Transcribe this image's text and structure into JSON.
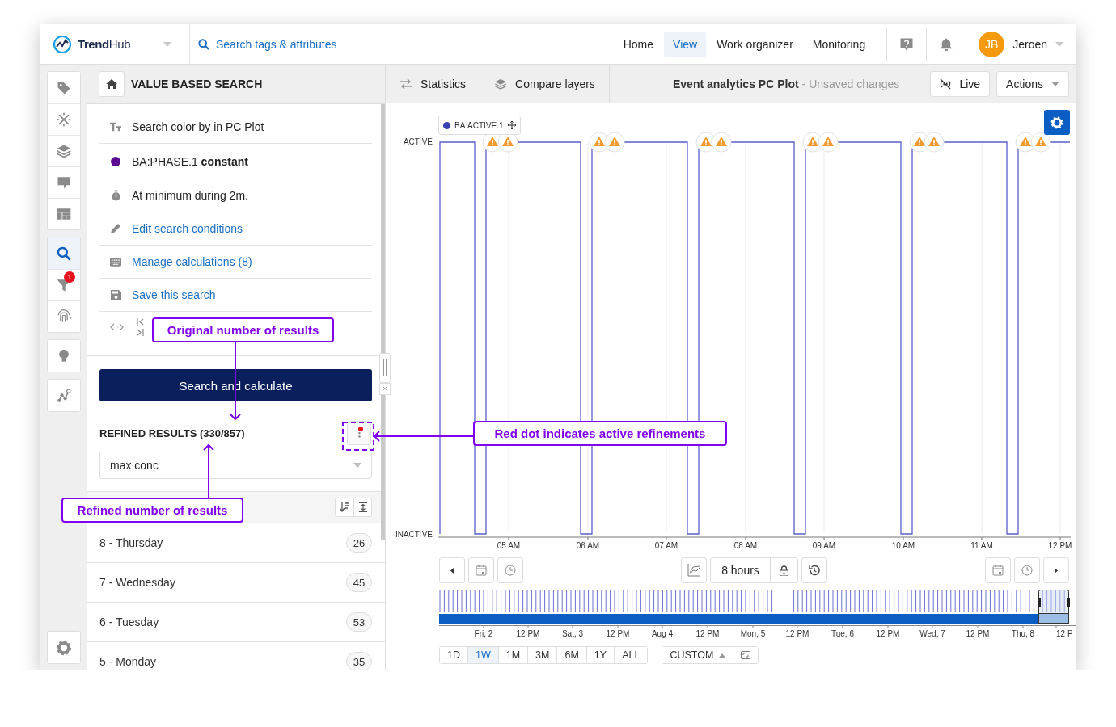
{
  "top_bar": {
    "brand": "**Trend**Hub",
    "search": "Search tags & attributes",
    "nav": [
      {
        "label": "Home",
        "selected": false
      },
      {
        "label": "View",
        "selected": true
      },
      {
        "label": "Work organizer",
        "selected": false
      },
      {
        "label": "Monitoring",
        "selected": false
      }
    ],
    "user": {
      "initials": "JB",
      "name": "Jeroen"
    }
  },
  "rail": {
    "groups": [
      {
        "items": [
          {
            "selected": false
          },
          {
            "selected": false
          },
          {
            "selected": false
          },
          {
            "selected": false
          },
          {
            "selected": false
          }
        ]
      },
      {
        "items": [
          {
            "selected": true
          },
          {
            "selected": false,
            "badge": "1"
          },
          {
            "selected": false
          }
        ]
      },
      {
        "items": [
          {
            "selected": false
          }
        ]
      },
      {
        "items": [
          {
            "selected": false
          }
        ]
      }
    ]
  },
  "search_panel": {
    "title": "VALUE BASED SEARCH",
    "conditions": [
      {
        "kind": "text",
        "text": "Search color by in PC Plot"
      },
      {
        "kind": "tag",
        "text": "BA:PHASE.1 **constant**"
      },
      {
        "kind": "text",
        "text": "At minimum during 2m."
      },
      {
        "kind": "link",
        "text": "Edit search conditions"
      },
      {
        "kind": "link",
        "text": "Manage calculations (8)"
      },
      {
        "kind": "link",
        "text": "Save this search"
      }
    ],
    "action": "Search and calculate",
    "results": {
      "title": "REFINED RESULTS (330/857)",
      "refined": true,
      "sort_field": "max conc",
      "rows": [
        {
          "label": "8 - Thursday",
          "count": "26"
        },
        {
          "label": "7 - Wednesday",
          "count": "45"
        },
        {
          "label": "6 - Tuesday",
          "count": "53"
        },
        {
          "label": "5 - Monday",
          "count": "35"
        }
      ]
    }
  },
  "chart": {
    "tools": [
      "Statistics",
      "Compare layers"
    ],
    "title": "Event analytics PC Plot",
    "status": "- Unsaved changes",
    "live": "Live",
    "actions": "Actions",
    "legend": "BA:ACTIVE.1",
    "y_labels": [
      "ACTIVE",
      "INACTIVE"
    ],
    "x_ticks": [
      "05 AM",
      "06 AM",
      "07 AM",
      "08 AM",
      "09 AM",
      "10 AM",
      "11 AM",
      "12 PM"
    ],
    "duration": "8 hours",
    "navigator_ticks": [
      "Fri, 2",
      "12 PM",
      "Sat, 3",
      "12 PM",
      "Aug 4",
      "12 PM",
      "Mon, 5",
      "12 PM",
      "Tue, 6",
      "12 PM",
      "Wed, 7",
      "12 PM",
      "Thu, 8",
      "12 P"
    ],
    "ranges": [
      {
        "label": "1D",
        "selected": false
      },
      {
        "label": "1W",
        "selected": true
      },
      {
        "label": "1M",
        "selected": false
      },
      {
        "label": "3M",
        "selected": false
      },
      {
        "label": "6M",
        "selected": false
      },
      {
        "label": "1Y",
        "selected": false
      },
      {
        "label": "ALL",
        "selected": false
      }
    ],
    "custom": "CUSTOM"
  },
  "annotations": [
    "Original number of results",
    "Red dot indicates active refinements",
    "Refined number of results"
  ]
}
